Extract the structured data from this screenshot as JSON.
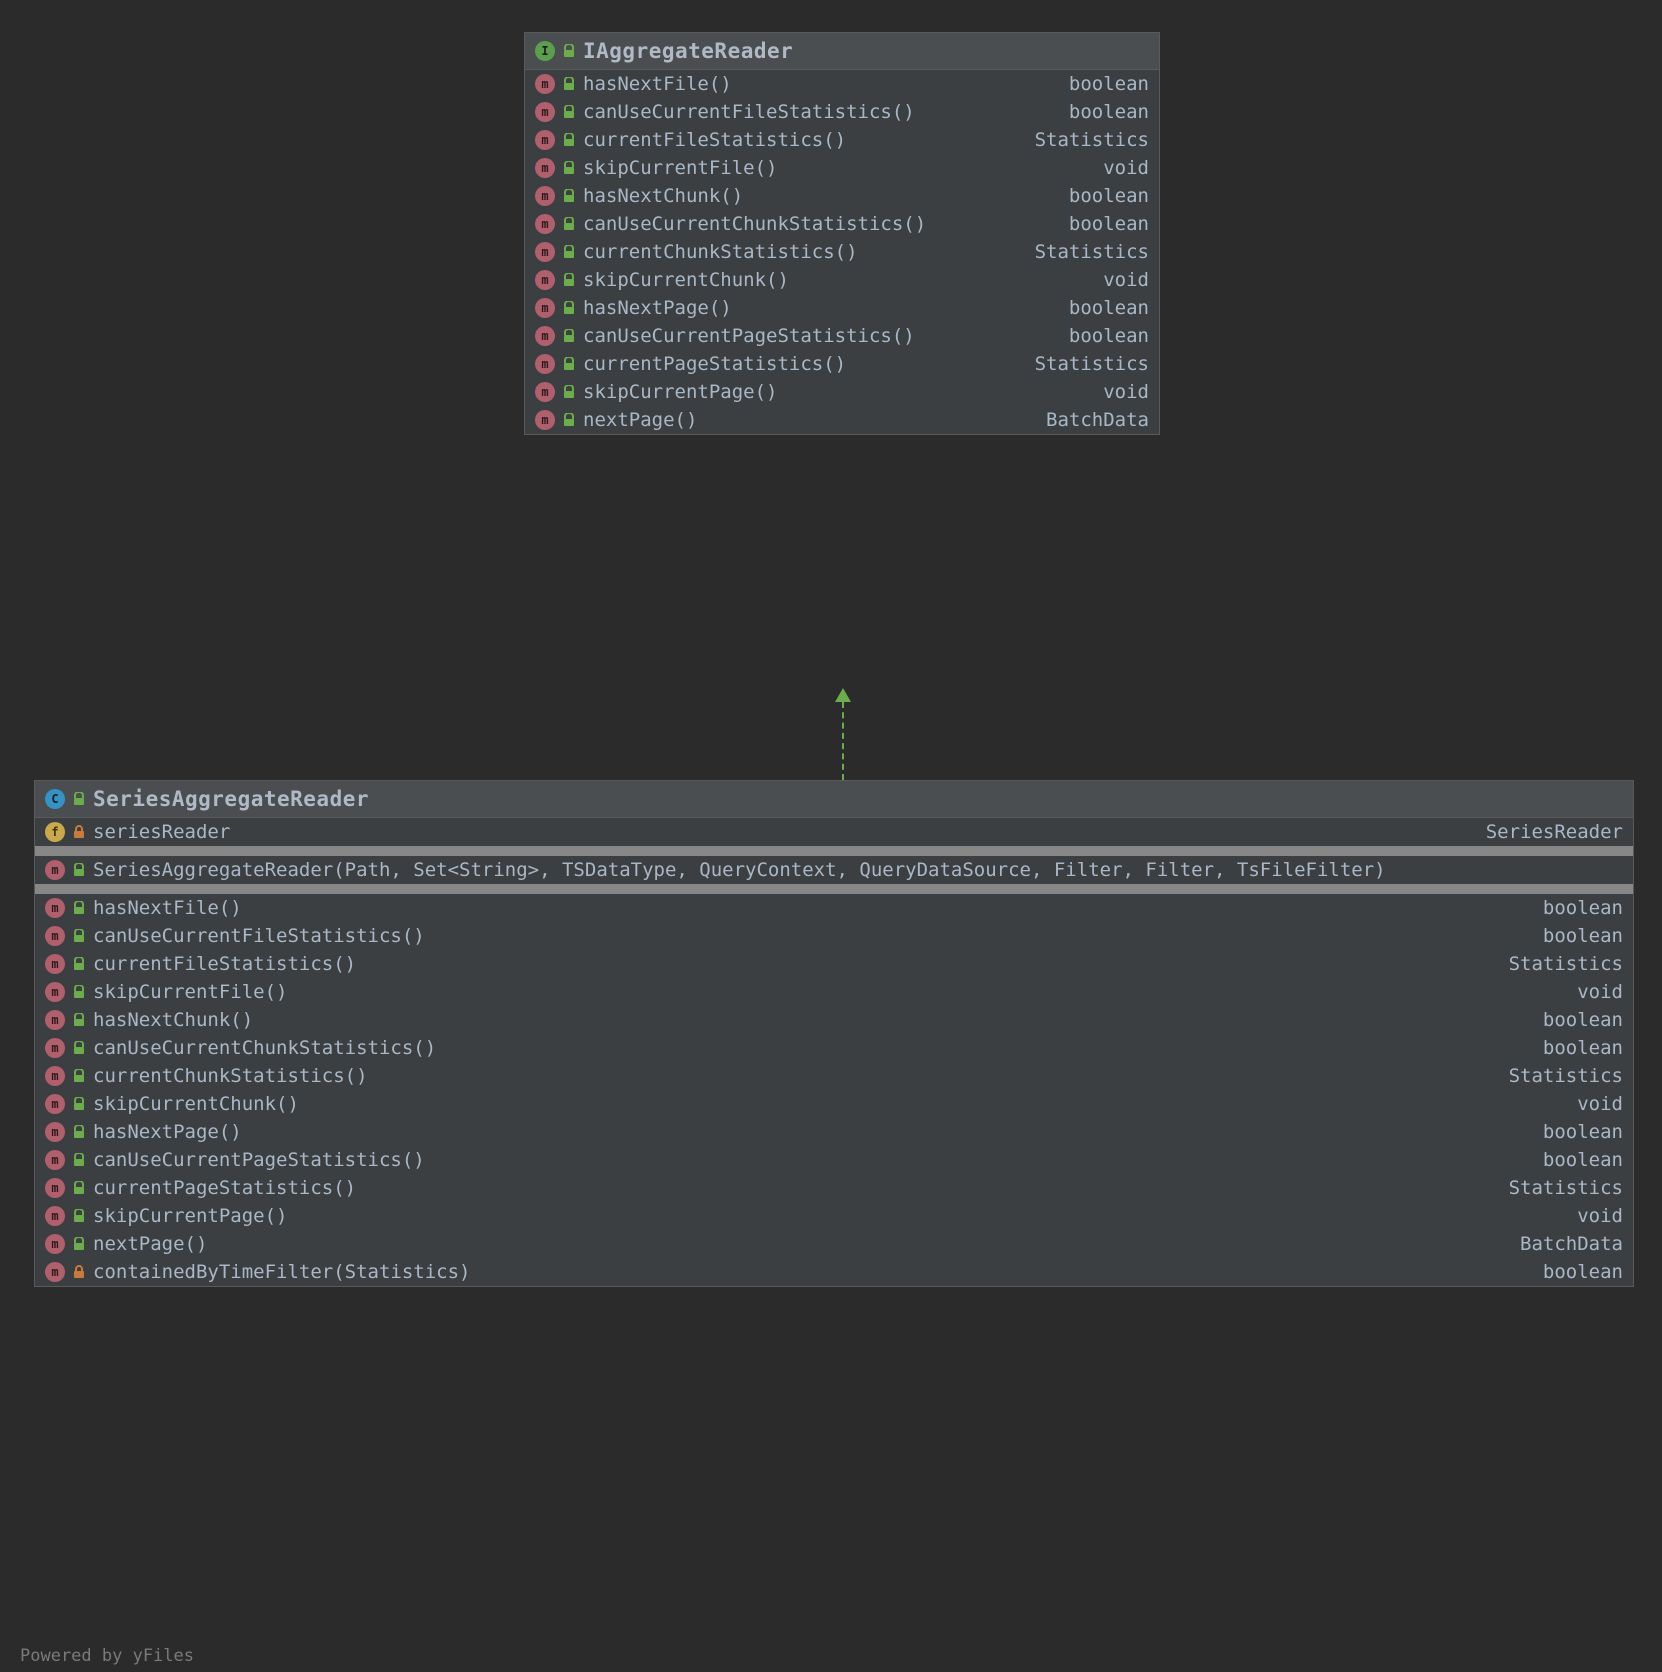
{
  "watermark": "Powered by yFiles",
  "interface_panel": {
    "title": "IAggregateReader",
    "type_icon": "I",
    "members": [
      {
        "name": "hasNextFile()",
        "ret": "boolean"
      },
      {
        "name": "canUseCurrentFileStatistics()",
        "ret": "boolean"
      },
      {
        "name": "currentFileStatistics()",
        "ret": "Statistics"
      },
      {
        "name": "skipCurrentFile()",
        "ret": "void"
      },
      {
        "name": "hasNextChunk()",
        "ret": "boolean"
      },
      {
        "name": "canUseCurrentChunkStatistics()",
        "ret": "boolean"
      },
      {
        "name": "currentChunkStatistics()",
        "ret": "Statistics"
      },
      {
        "name": "skipCurrentChunk()",
        "ret": "void"
      },
      {
        "name": "hasNextPage()",
        "ret": "boolean"
      },
      {
        "name": "canUseCurrentPageStatistics()",
        "ret": "boolean"
      },
      {
        "name": "currentPageStatistics()",
        "ret": "Statistics"
      },
      {
        "name": "skipCurrentPage()",
        "ret": "void"
      },
      {
        "name": "nextPage()",
        "ret": "BatchData"
      }
    ]
  },
  "class_panel": {
    "title": "SeriesAggregateReader",
    "type_icon": "C",
    "fields": [
      {
        "name": "seriesReader",
        "ret": "SeriesReader",
        "vis": "private"
      }
    ],
    "constructors": [
      {
        "name": "SeriesAggregateReader(Path, Set<String>, TSDataType, QueryContext, QueryDataSource, Filter, Filter, TsFileFilter)",
        "ret": ""
      }
    ],
    "methods": [
      {
        "name": "hasNextFile()",
        "ret": "boolean",
        "vis": "public"
      },
      {
        "name": "canUseCurrentFileStatistics()",
        "ret": "boolean",
        "vis": "public"
      },
      {
        "name": "currentFileStatistics()",
        "ret": "Statistics",
        "vis": "public"
      },
      {
        "name": "skipCurrentFile()",
        "ret": "void",
        "vis": "public"
      },
      {
        "name": "hasNextChunk()",
        "ret": "boolean",
        "vis": "public"
      },
      {
        "name": "canUseCurrentChunkStatistics()",
        "ret": "boolean",
        "vis": "public"
      },
      {
        "name": "currentChunkStatistics()",
        "ret": "Statistics",
        "vis": "public"
      },
      {
        "name": "skipCurrentChunk()",
        "ret": "void",
        "vis": "public"
      },
      {
        "name": "hasNextPage()",
        "ret": "boolean",
        "vis": "public"
      },
      {
        "name": "canUseCurrentPageStatistics()",
        "ret": "boolean",
        "vis": "public"
      },
      {
        "name": "currentPageStatistics()",
        "ret": "Statistics",
        "vis": "public"
      },
      {
        "name": "skipCurrentPage()",
        "ret": "void",
        "vis": "public"
      },
      {
        "name": "nextPage()",
        "ret": "BatchData",
        "vis": "public"
      },
      {
        "name": "containedByTimeFilter(Statistics)",
        "ret": "boolean",
        "vis": "private"
      }
    ]
  }
}
